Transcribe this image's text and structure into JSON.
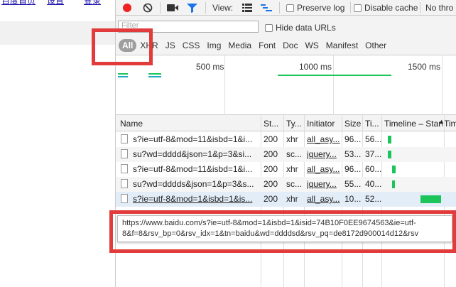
{
  "page": {
    "top_links": [
      "百度首页",
      "设置",
      "登录"
    ],
    "accent": "#e23b3b"
  },
  "toolbar": {
    "view_label": "View:",
    "preserve_log": "Preserve log",
    "disable_cache": "Disable cache",
    "throttle": "No thro"
  },
  "filter": {
    "placeholder": "Filter",
    "hide_data_urls": "Hide data URLs",
    "types": [
      "All",
      "XHR",
      "JS",
      "CSS",
      "Img",
      "Media",
      "Font",
      "Doc",
      "WS",
      "Manifest",
      "Other"
    ],
    "active_type": "All"
  },
  "overview": {
    "ticks": [
      "500 ms",
      "1000 ms",
      "1500 ms"
    ]
  },
  "table": {
    "columns": [
      "Name",
      "St...",
      "Ty...",
      "Initiator",
      "Size",
      "Ti...",
      "Timeline – Start",
      "Tim"
    ],
    "sort_indicator": "▲",
    "rows": [
      {
        "name": "s?ie=utf-8&mod=11&isbd=1&i...",
        "status": "200",
        "type": "xhr",
        "initiator": "all_asy...",
        "size": "96...",
        "time": "56...",
        "timeline_start": 0.08,
        "timeline_width": 0.06
      },
      {
        "name": "su?wd=dddd&json=1&p=3&si...",
        "status": "200",
        "type": "sc...",
        "initiator": "jquery...",
        "size": "53...",
        "time": "37...",
        "timeline_start": 0.08,
        "timeline_width": 0.06
      },
      {
        "name": "s?ie=utf-8&mod=11&isbd=1&i...",
        "status": "200",
        "type": "xhr",
        "initiator": "all_asy...",
        "size": "96...",
        "time": "60...",
        "timeline_start": 0.16,
        "timeline_width": 0.06
      },
      {
        "name": "su?wd=dddds&json=1&p=3&s...",
        "status": "200",
        "type": "sc...",
        "initiator": "jquery...",
        "size": "55...",
        "time": "40...",
        "timeline_start": 0.16,
        "timeline_width": 0.04
      },
      {
        "name": "s?ie=utf-8&mod=1&isbd=1&is...",
        "status": "200",
        "type": "xhr",
        "initiator": "all_asy...",
        "size": "10...",
        "time": "52...",
        "timeline_start": 0.63,
        "timeline_width": 0.35
      }
    ]
  },
  "tooltip": {
    "line1": "https://www.baidu.com/s?ie=utf-8&mod=1&isbd=1&isid=74B10F0EE9674563&ie=utf-",
    "line2": "8&f=8&rsv_bp=0&rsv_idx=1&tn=baidu&wd=ddddsd&rsv_pq=de8172d900014d12&rsv"
  }
}
